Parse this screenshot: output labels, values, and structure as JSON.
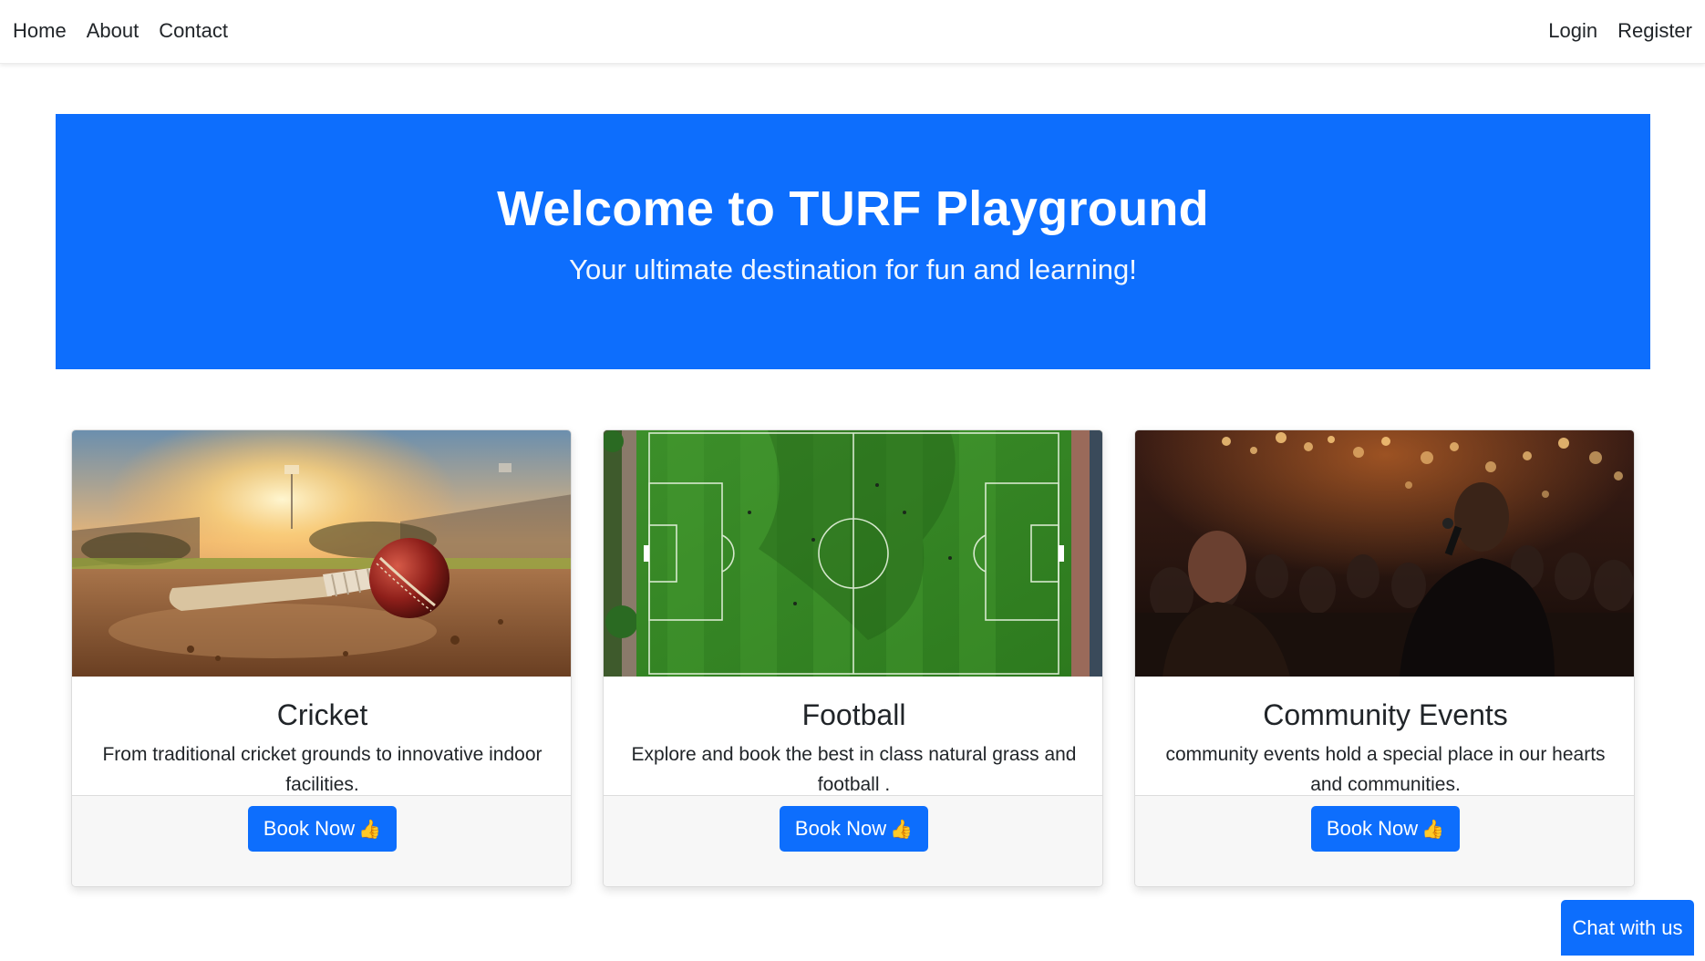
{
  "nav": {
    "left": [
      {
        "label": "Home"
      },
      {
        "label": "About"
      },
      {
        "label": "Contact"
      }
    ],
    "right": [
      {
        "label": "Login"
      },
      {
        "label": "Register"
      }
    ]
  },
  "hero": {
    "title": "Welcome to TURF Playground",
    "subtitle": "Your ultimate destination for fun and learning!",
    "background_color": "#0d6efd"
  },
  "cards": [
    {
      "image": "cricket-ball-and-bat-photo",
      "title": "Cricket",
      "text": "From traditional cricket grounds to innovative indoor facilities.",
      "button_label": "Book Now",
      "button_icon": "thumbs-up-icon"
    },
    {
      "image": "football-field-aerial-photo",
      "title": "Football",
      "text": "Explore and book the best in class natural grass and football .",
      "button_label": "Book Now",
      "button_icon": "thumbs-up-icon"
    },
    {
      "image": "community-event-crowd-photo",
      "title": "Community Events",
      "text": "community events hold a special place in our hearts and communities.",
      "button_label": "Book Now",
      "button_icon": "thumbs-up-icon"
    }
  ],
  "chat": {
    "label": "Chat with us"
  },
  "colors": {
    "primary": "#0d6efd",
    "text": "#212529",
    "card_footer_bg": "#f7f7f7"
  }
}
